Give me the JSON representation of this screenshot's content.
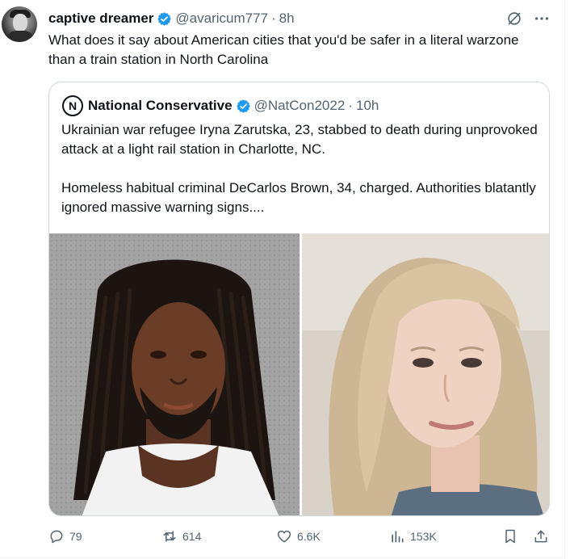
{
  "tweet": {
    "author_name": "captive dreamer",
    "author_handle": "@avaricum777",
    "separator": "·",
    "time": "8h",
    "text": "What does it say about American cities that you'd be safer in a literal warzone than a train station in North Carolina"
  },
  "quote": {
    "logo_letter": "N",
    "author_name": "National Conservative",
    "author_handle": "@NatCon2022",
    "separator": "·",
    "time": "10h",
    "paragraph_1": "Ukrainian war refugee Iryna Zarutska, 23, stabbed to death during unprovoked attack at a light rail station in Charlotte, NC.",
    "paragraph_2": "Homeless habitual criminal DeCarlos Brown, 34, charged. Authorities blatantly ignored massive warning signs...."
  },
  "actions": {
    "replies": "79",
    "reposts": "614",
    "likes": "6.6K",
    "views": "153K"
  },
  "icons": {
    "verified": "verified-badge-icon",
    "grok": "grok-icon",
    "more": "more-icon",
    "reply": "reply-icon",
    "repost": "repost-icon",
    "like": "like-icon",
    "views": "views-icon",
    "bookmark": "bookmark-icon",
    "share": "share-icon"
  },
  "colors": {
    "text_primary": "#0f1419",
    "text_secondary": "#536471",
    "verified_blue": "#1d9bf0",
    "border": "#cfd9de"
  }
}
